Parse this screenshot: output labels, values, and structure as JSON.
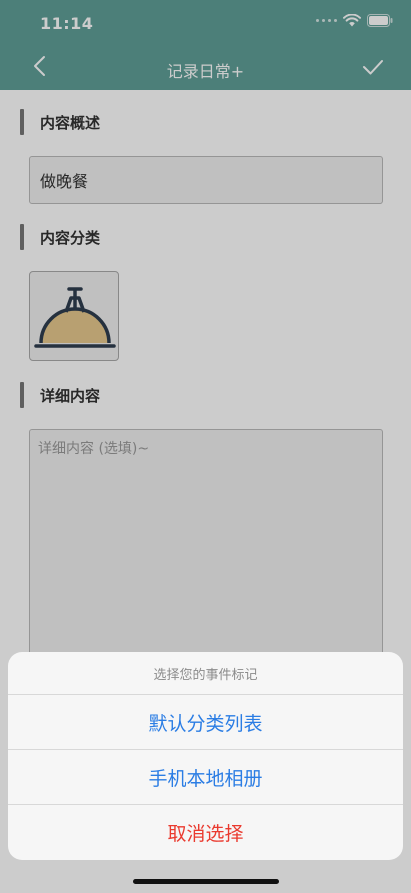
{
  "status_bar": {
    "time": "11:14"
  },
  "header": {
    "title": "记录日常+"
  },
  "sections": {
    "summary_label": "内容概述",
    "summary_value": "做晚餐",
    "category_label": "内容分类",
    "category_icon": "dinner-cloche-icon",
    "detail_label": "详细内容",
    "detail_placeholder": "详细内容 (选填)~"
  },
  "action_sheet": {
    "title": "选择您的事件标记",
    "options": [
      {
        "label": "默认分类列表"
      },
      {
        "label": "手机本地相册"
      }
    ],
    "cancel": "取消选择"
  },
  "colors": {
    "header": "#5f9f98",
    "action_blue": "#2b7de4",
    "cancel_red": "#ea3a2f",
    "cloche_fill": "#e6c98e",
    "cloche_stroke": "#2f3e4f"
  }
}
